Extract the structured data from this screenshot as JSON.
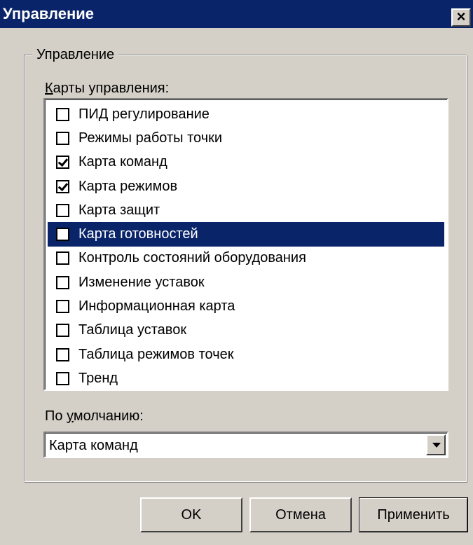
{
  "window": {
    "title": "Управление",
    "close_label": "×"
  },
  "group": {
    "title": "Управление",
    "list_label_accel": "К",
    "list_label_rest": "арты управления:",
    "items": [
      {
        "label": "ПИД регулирование",
        "checked": false,
        "selected": false
      },
      {
        "label": "Режимы работы точки",
        "checked": false,
        "selected": false
      },
      {
        "label": "Карта команд",
        "checked": true,
        "selected": false
      },
      {
        "label": "Карта режимов",
        "checked": true,
        "selected": false
      },
      {
        "label": "Карта защит",
        "checked": false,
        "selected": false
      },
      {
        "label": "Карта готовностей",
        "checked": false,
        "selected": true
      },
      {
        "label": "Контроль состояний оборудования",
        "checked": false,
        "selected": false
      },
      {
        "label": "Изменение уставок",
        "checked": false,
        "selected": false
      },
      {
        "label": "Информационная карта",
        "checked": false,
        "selected": false
      },
      {
        "label": "Таблица уставок",
        "checked": false,
        "selected": false
      },
      {
        "label": "Таблица режимов точек",
        "checked": false,
        "selected": false
      },
      {
        "label": "Тренд",
        "checked": false,
        "selected": false
      }
    ],
    "default_label_pre": "По ",
    "default_label_accel": "у",
    "default_label_post": "молчанию:",
    "default_value": "Карта команд"
  },
  "buttons": {
    "ok": "OK",
    "cancel": "Отмена",
    "apply": "Применить"
  },
  "colors": {
    "titlebar": "#0a246a",
    "face": "#d4d0c8",
    "selection": "#0a246a"
  }
}
